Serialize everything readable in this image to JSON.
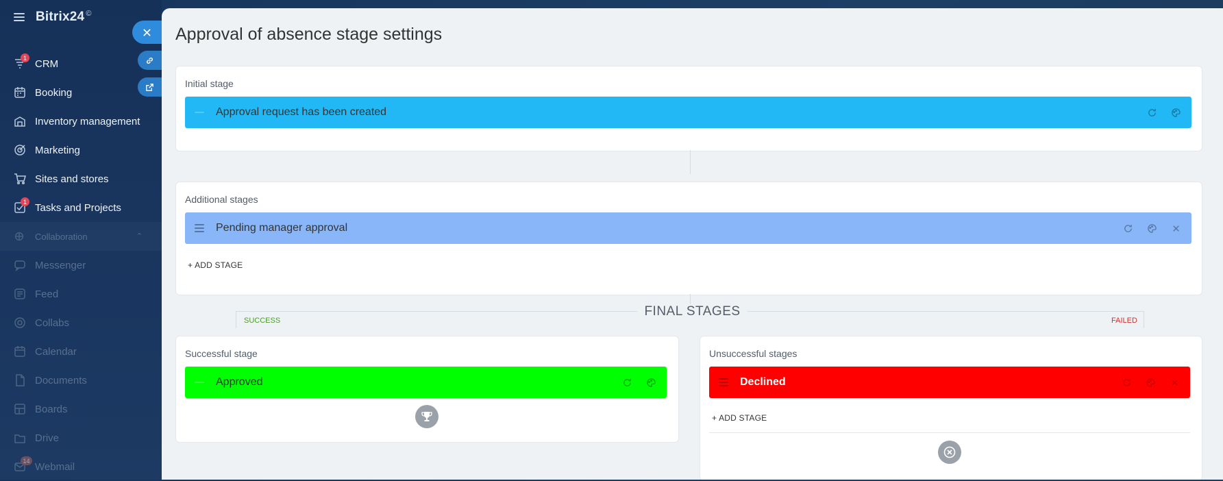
{
  "app": {
    "name": "Bitrix24",
    "logo_mark": "©"
  },
  "sidebar": {
    "items": [
      {
        "label": "CRM",
        "icon": "crm-funnel-icon",
        "badge": "1"
      },
      {
        "label": "Booking",
        "icon": "booking-calendar-icon",
        "badge": ""
      },
      {
        "label": "Inventory management",
        "icon": "inventory-icon",
        "badge": ""
      },
      {
        "label": "Marketing",
        "icon": "marketing-target-icon",
        "badge": ""
      },
      {
        "label": "Sites and stores",
        "icon": "cart-icon",
        "badge": ""
      },
      {
        "label": "Tasks and Projects",
        "icon": "tasks-check-icon",
        "badge": "1"
      }
    ],
    "group": {
      "label": "Collaboration",
      "icon": "collaboration-icon"
    },
    "group_items": [
      {
        "label": "Messenger",
        "icon": "messenger-icon"
      },
      {
        "label": "Feed",
        "icon": "feed-icon"
      },
      {
        "label": "Collabs",
        "icon": "collabs-icon"
      },
      {
        "label": "Calendar",
        "icon": "calendar-icon"
      },
      {
        "label": "Documents",
        "icon": "documents-icon"
      },
      {
        "label": "Boards",
        "icon": "boards-icon"
      },
      {
        "label": "Drive",
        "icon": "drive-icon"
      },
      {
        "label": "Webmail",
        "icon": "webmail-icon",
        "badge": "14"
      }
    ]
  },
  "panel": {
    "title": "Approval of absence stage settings",
    "initial": {
      "label": "Initial stage",
      "stage": {
        "name": "Approval request has been created",
        "color": "#22b8f5"
      }
    },
    "additional": {
      "label": "Additional stages",
      "stages": [
        {
          "name": "Pending manager approval",
          "color": "#88b6f9"
        }
      ],
      "add_label": "+ ADD STAGE"
    },
    "final": {
      "title": "FINAL STAGES",
      "success_label": "SUCCESS",
      "failed_label": "FAILED",
      "successful": {
        "label": "Successful stage",
        "stage": {
          "name": "Approved",
          "color": "#00ff00"
        }
      },
      "unsuccessful": {
        "label": "Unsuccessful stages",
        "stage": {
          "name": "Declined",
          "color": "#ff0000"
        },
        "add_label": "+ ADD STAGE"
      }
    }
  },
  "colors": {
    "accent": "#2f8bdc",
    "success_text": "#4c9a2a",
    "failed_text": "#d32f2f"
  }
}
